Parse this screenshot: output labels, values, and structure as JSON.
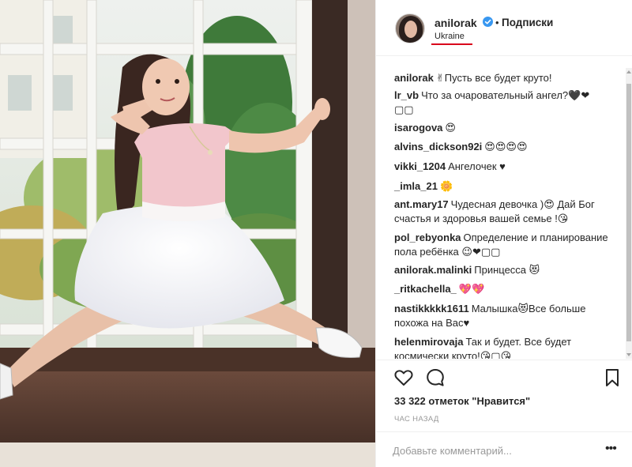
{
  "post": {
    "username": "anilorak",
    "verified_icon": "verified-badge-icon",
    "separator": "•",
    "follow_label": "Подписки",
    "location": "Ukraine",
    "accent_color": "#3897f0",
    "underline_color": "#d9001b"
  },
  "comments": [
    {
      "user": "anilorak",
      "text": "✌Пусть все будет круто!"
    },
    {
      "user": "lr_vb",
      "text": "Что за очаровательный ангел?🖤❤ ▢▢"
    },
    {
      "user": "isarogova",
      "text": "😍"
    },
    {
      "user": "alvins_dickson92i",
      "text": "😍😍😍😍"
    },
    {
      "user": "vikki_1204",
      "text": "Ангелочек ♥"
    },
    {
      "user": "_imla_21",
      "text": "🌼"
    },
    {
      "user": "ant.mary17",
      "text": "Чудесная девочка )😍 Дай Бог счастья и здоровья вашей семье !😘"
    },
    {
      "user": "pol_rebyonka",
      "text": "Определение и планирование пола ребёнка 😉❤▢▢"
    },
    {
      "user": "anilorak.malinki",
      "text": "Принцесса 😻"
    },
    {
      "user": "_ritkachella_",
      "text": "💖💖"
    },
    {
      "user": "nastikkkkk1611",
      "text": "Малышка😻Все больше похожа на Вас♥"
    },
    {
      "user": "helenmirovaja",
      "text": "Так и будет. Все будет космически круто!😘▢😘"
    }
  ],
  "actions": {
    "like_icon": "heart-icon",
    "comment_icon": "comment-bubble-icon",
    "save_icon": "bookmark-icon",
    "likes_text": "33 322 отметок \"Нравится\"",
    "time_text": "ЧАС НАЗАД"
  },
  "comment_box": {
    "placeholder": "Добавьте комментарий...",
    "more_icon": "more-options-icon",
    "more_label": "•••"
  }
}
